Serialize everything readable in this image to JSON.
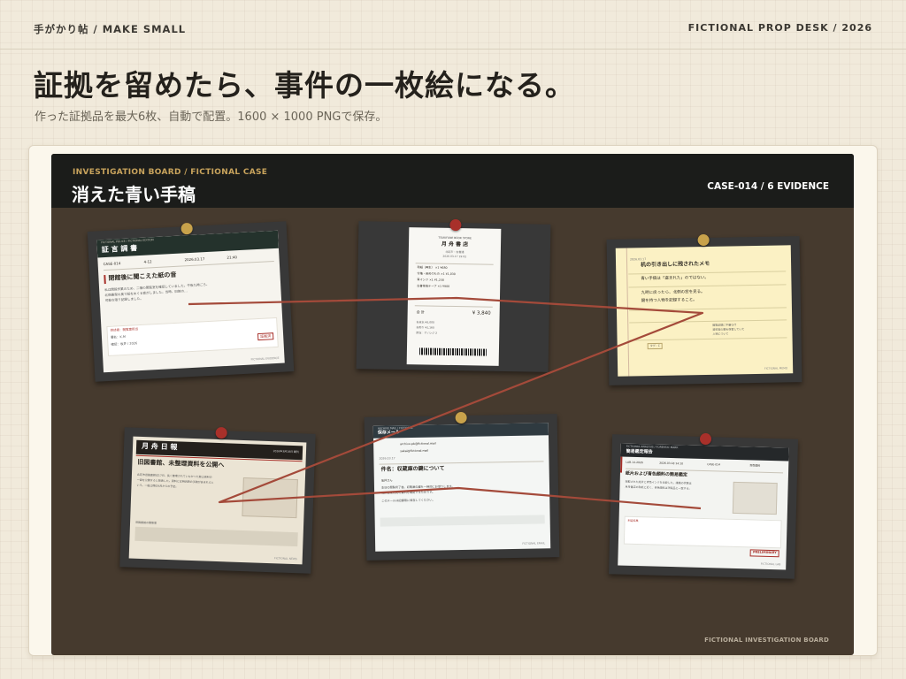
{
  "header": {
    "brand": "手がかり帖 / MAKE SMALL",
    "desk": "FICTIONAL PROP DESK / 2026"
  },
  "hero": {
    "title": "証拠を留めたら、事件の一枚絵になる。",
    "subtitle": "作った証拠品を最大6枚、自動で配置。1600 × 1000 PNGで保存。"
  },
  "board": {
    "subtitle": "INVESTIGATION BOARD / FICTIONAL CASE",
    "title": "消えた青い手稿",
    "case_label": "CASE-014 / 6 EVIDENCE",
    "footer": "FICTIONAL INVESTIGATION BOARD"
  },
  "cards": {
    "testimony": {
      "org": "FICTIONAL POLICE / FICTIONAL EDITION",
      "title": "証 言 調 書",
      "meta": [
        "CASE-014",
        "4-12",
        "2026.03.17",
        "21:40"
      ],
      "headline": "閉館後に聞こえた紙の音",
      "body": [
        "私は閉館作業のため、二階の閲覧室を確認していました。午後九時ごろ、",
        "北側書架の奥で紙をめくる音がしました。当時、旧館の…",
        "可能な限り記録しました。"
      ],
      "notes": [
        "供述者：閲覧室担当",
        "署名：K.M",
        "確認：坂井 / 2026"
      ],
      "stamp": "証拠済",
      "footer": "FICTIONAL EVIDENCE"
    },
    "receipt": {
      "shop_en": "TSUKIFUNE BOOK STORE",
      "shop": "月 舟 書 店",
      "addr": "北区市・古書通",
      "date": "2026.03.17 19:02",
      "items": [
        "和紙（再生）  ×1  ¥680",
        "付箋・長めのもの  ×1  ¥1,030",
        "青インク  ×1  ¥1,230",
        "古書修復テープ  ×1  ¥900"
      ],
      "total_label": "合 計",
      "total": "¥ 3,840",
      "pay": [
        "お支払 ¥5,000",
        "お釣り ¥1,160",
        "担当：オ / レジ 2"
      ]
    },
    "memo": {
      "date": "2026.03.17",
      "title": "机の引き出しに残されたメモ",
      "lines": [
        "青い手稿は「盗まれた」のではない。",
        "九時に戻ったら、北側の窓を見る。",
        "鍵を持つ人物を記録すること。"
      ],
      "note": [
        "閲覧記録に不審な行",
        "資料室の鍵を保管していた",
        "人物について"
      ],
      "tag": "タグ：C",
      "footer": "FICTIONAL MEMO"
    },
    "newspaper": {
      "masthead": "月 舟 日 報",
      "edition": "2026年3月18日 朝刊",
      "headline": "旧図書館、未整理資料を公開へ",
      "body": [
        "北区市旧図書館は17日、長く整理されていなかった郷土資料の",
        "一部を公開すると発表した。資料には明治期の手稿が含まれると",
        "いう。一般公開は4月からの予定。"
      ],
      "caption": "旧図書館の閲覧室",
      "footer": "FICTIONAL NEWS"
    },
    "email": {
      "brand": "ARCHIVE MAIL / FICTIONAL",
      "label": "保存メール",
      "from": "archive-pb@fictional.mail",
      "to": "sakai@fictional.mail",
      "date": "2026.03.17",
      "subject": "件名：収蔵庫の鍵について",
      "greeting": "坂井さん",
      "body": [
        "本日の閲覧終了後、収蔵庫の鍵を一時的にお借りします。",
        "北側書架の奥の資料を確認するためです。",
        "このメールは記録用に保存してください。"
      ],
      "footer": "FICTIONAL EMAIL"
    },
    "report": {
      "org": "FICTIONAL ANALYSIS / FORENSIC MARK",
      "title": "簡易鑑定報告",
      "meta": [
        "LAB-14-2026",
        "2026.03.18 14:10",
        "CASE-014",
        "青色顔料"
      ],
      "headline": "紙片および青色顔料の簡易鑑定",
      "body": [
        "採取された紙片と青色インクを比較した。繊維の状態は",
        "月舟書店の和紙と近く、青色顔料は市販品と一致する。"
      ],
      "result_label": "判定結果",
      "stamp": "PRELIMINARY",
      "footer": "FICTIONAL LAB"
    }
  },
  "colors": {
    "board": "#463a2e",
    "thread": "#a44a3a",
    "pin_gold": "#c8a24b",
    "pin_red": "#a8302a",
    "header": "#1b1c1a",
    "accent": "#c8a35c"
  }
}
